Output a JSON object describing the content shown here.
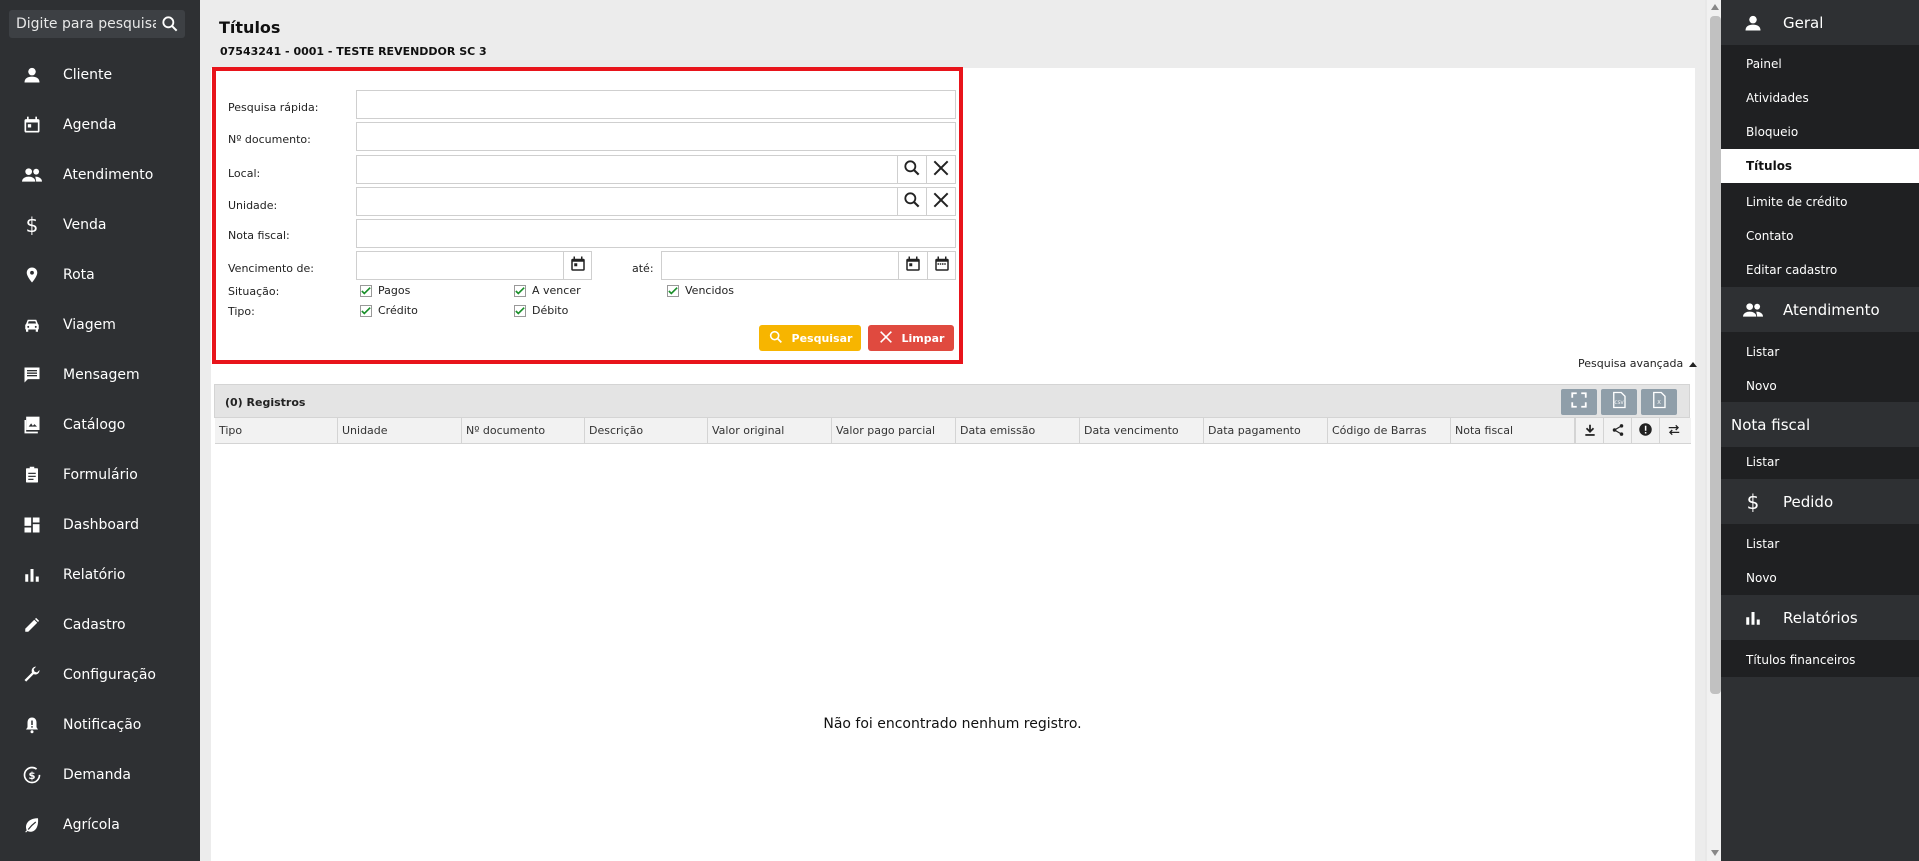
{
  "search": {
    "placeholder": "Digite para pesquisar..."
  },
  "left_nav": [
    {
      "label": "Cliente",
      "icon": "person-icon"
    },
    {
      "label": "Agenda",
      "icon": "calendar-icon"
    },
    {
      "label": "Atendimento",
      "icon": "people-icon"
    },
    {
      "label": "Venda",
      "icon": "dollar-icon"
    },
    {
      "label": "Rota",
      "icon": "location-pin-icon"
    },
    {
      "label": "Viagem",
      "icon": "car-icon"
    },
    {
      "label": "Mensagem",
      "icon": "message-icon"
    },
    {
      "label": "Catálogo",
      "icon": "catalog-icon"
    },
    {
      "label": "Formulário",
      "icon": "clipboard-icon"
    },
    {
      "label": "Dashboard",
      "icon": "dashboard-icon"
    },
    {
      "label": "Relatório",
      "icon": "bar-chart-icon"
    },
    {
      "label": "Cadastro",
      "icon": "pencil-icon"
    },
    {
      "label": "Configuração",
      "icon": "wrench-icon"
    },
    {
      "label": "Notificação",
      "icon": "bell-alert-icon"
    },
    {
      "label": "Demanda",
      "icon": "money-cycle-icon"
    },
    {
      "label": "Agrícola",
      "icon": "leaf-icon"
    }
  ],
  "page": {
    "title": "Títulos",
    "subtitle": "07543241 - 0001 - TESTE REVENDDOR SC 3"
  },
  "form": {
    "quick_search_label": "Pesquisa rápida:",
    "quick_search_value": "",
    "doc_number_label": "Nº documento:",
    "local_label": "Local:",
    "unit_label": "Unidade:",
    "invoice_label": "Nota fiscal:",
    "due_from_label": "Vencimento de:",
    "due_to_label": "até:",
    "status_label": "Situação:",
    "type_label": "Tipo:",
    "status_options": [
      {
        "label": "Pagos",
        "checked": true
      },
      {
        "label": "A vencer",
        "checked": true
      },
      {
        "label": "Vencidos",
        "checked": true
      }
    ],
    "type_options": [
      {
        "label": "Crédito",
        "checked": true
      },
      {
        "label": "Débito",
        "checked": true
      }
    ],
    "search_button": "Pesquisar",
    "clear_button": "Limpar",
    "advanced_search": "Pesquisa avançada"
  },
  "grid": {
    "records_label": "(0) Registros",
    "columns": [
      "Tipo",
      "Unidade",
      "Nº documento",
      "Descrição",
      "Valor original",
      "Valor pago parcial",
      "Data emissão",
      "Data vencimento",
      "Data pagamento",
      "Código de Barras",
      "Nota fiscal"
    ],
    "empty_message": "Não foi encontrado nenhum registro."
  },
  "right_nav": {
    "sections": [
      {
        "label": "Geral",
        "icon": "person-icon",
        "items": [
          "Painel",
          "Atividades",
          "Bloqueio",
          "Títulos",
          "Limite de crédito",
          "Contato",
          "Editar cadastro"
        ]
      },
      {
        "label": "Atendimento",
        "icon": "people-icon",
        "items": [
          "Listar",
          "Novo"
        ]
      },
      {
        "label": "Nota fiscal",
        "icon": "",
        "items": [
          "Listar"
        ]
      },
      {
        "label": "Pedido",
        "icon": "dollar-icon",
        "items": [
          "Listar",
          "Novo"
        ]
      },
      {
        "label": "Relatórios",
        "icon": "bar-chart-icon",
        "items": [
          "Títulos financeiros"
        ]
      }
    ],
    "active_item": "Títulos"
  },
  "colors": {
    "sidebar_bg": "#2e3033",
    "highlight_border": "#e8141b",
    "search_button": "#f7b500",
    "clear_button": "#e04a3f",
    "tool_button": "#8f9ea9"
  }
}
